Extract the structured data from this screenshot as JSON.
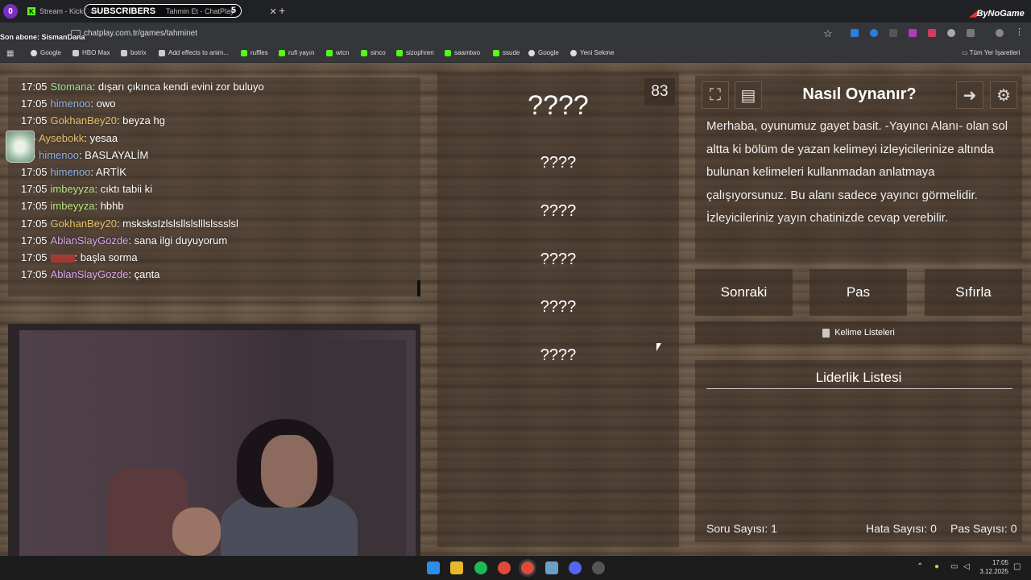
{
  "browser": {
    "profile_badge": "0",
    "tabs": [
      {
        "label": "Stream - Kick Dash"
      },
      {
        "label": "Tahmin Et - ChatPlay"
      }
    ],
    "subscribers_label": "SUBSCRIBERS",
    "subscribers_count": "5",
    "new_tab_symbol": "+",
    "overlay_brand": "ByNoGame",
    "son_abone": "Son abone: SismanDana",
    "url": "chatplay.com.tr/games/tahminet",
    "bookmarks": [
      {
        "label": "Google",
        "icon": "google-icon"
      },
      {
        "label": "HBO Max",
        "icon": "hbo-icon"
      },
      {
        "label": "botrix",
        "icon": "botrix-icon"
      },
      {
        "label": "Add effects to anim...",
        "icon": "effects-icon"
      },
      {
        "label": "ruffles",
        "icon": "kick-icon"
      },
      {
        "label": "rufi yayın",
        "icon": "kick-icon"
      },
      {
        "label": "wtcn",
        "icon": "kick-icon"
      },
      {
        "label": "sinco",
        "icon": "kick-icon"
      },
      {
        "label": "sizophren",
        "icon": "kick-icon"
      },
      {
        "label": "saamtwo",
        "icon": "kick-icon"
      },
      {
        "label": "ssude",
        "icon": "kick-icon"
      },
      {
        "label": "Google",
        "icon": "google-icon"
      },
      {
        "label": "Yeni Sekme",
        "icon": "newtab-icon"
      }
    ],
    "all_bookmarks": "Tüm Yer İşaretleri"
  },
  "chat": {
    "messages": [
      {
        "time": "17:05",
        "user": "Stomana",
        "color": "#9be39b",
        "text": ": dışarı çıkınca kendi evini zor buluyo"
      },
      {
        "time": "17:05",
        "user": "himenoo",
        "color": "#8fb4e8",
        "text": ": owo"
      },
      {
        "time": "17:05",
        "user": "GokhanBey20",
        "color": "#e8c36a",
        "text": ": beyza hg"
      },
      {
        "time": ":05",
        "user": "Aysebokk",
        "color": "#e8c36a",
        "text": ": yesaa"
      },
      {
        "time": ":05",
        "user": "himenoo",
        "color": "#8fb4e8",
        "text": ": BASLAYALİM"
      },
      {
        "time": "17:05",
        "user": "himenoo",
        "color": "#8fb4e8",
        "text": ": ARTİK"
      },
      {
        "time": "17:05",
        "user": "imbeyyza",
        "color": "#b8e986",
        "text": ": cıktı tabii ki"
      },
      {
        "time": "17:05",
        "user": "imbeyyza",
        "color": "#b8e986",
        "text": ": hbhb"
      },
      {
        "time": "17:05",
        "user": "GokhanBey20",
        "color": "#e8c36a",
        "text": ": msksksIzlslsllslslllslssslsl"
      },
      {
        "time": "17:05",
        "user": "AblanSlayGozde",
        "color": "#d9a6f0",
        "text": ": sana ilgi duyuyorum"
      },
      {
        "time": "17:05",
        "user": "",
        "color": "#d83a3a",
        "text": ": başla sorma"
      },
      {
        "time": "17:05",
        "user": "AblanSlayGozde",
        "color": "#d9a6f0",
        "text": ": çanta"
      }
    ]
  },
  "game": {
    "counter": "83",
    "words": [
      "????",
      "????",
      "????",
      "????",
      "????",
      "????"
    ]
  },
  "help": {
    "title": "Nasıl Oynanır?",
    "text": "Merhaba, oyunumuz gayet basit. -Yayıncı Alanı- olan sol altta ki bölüm de yazan kelimeyi izleyicilerinize altında bulunan kelimeleri kullanmadan anlatmaya çalışıyorsunuz. Bu alanı sadece yayıncı görmelidir. İzleyicileriniz yayın chatinizde cevap verebilir."
  },
  "actions": {
    "next": "Sonraki",
    "pass": "Pas",
    "reset": "Sıfırla",
    "word_lists": "Kelime Listeleri"
  },
  "leaderboard": {
    "title": "Liderlik Listesi",
    "question_count": "Soru Sayısı: 1",
    "error_count": "Hata Sayısı: 0",
    "pass_count": "Pas Sayısı: 0"
  },
  "taskbar": {
    "time": "17:05",
    "date": "3.12.2025"
  }
}
